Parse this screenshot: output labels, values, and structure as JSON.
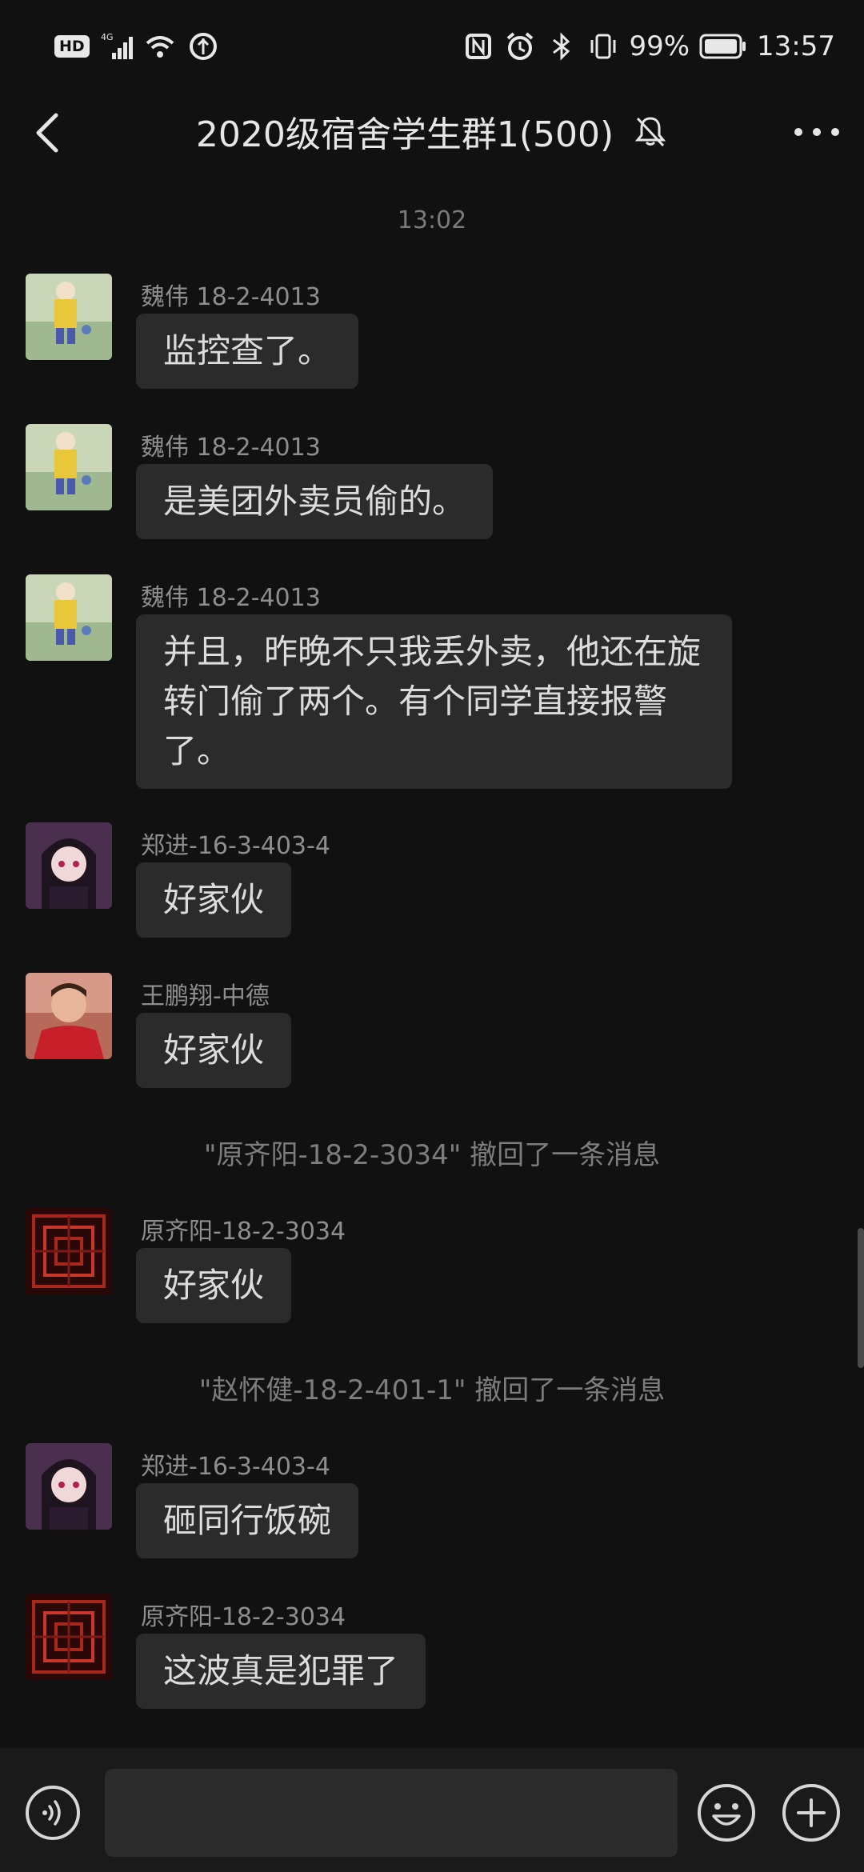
{
  "status_bar": {
    "hd_badge": "HD",
    "network": "4G",
    "battery_percent": "99%",
    "time": "13:57",
    "icons": [
      "hd-icon",
      "signal-icon",
      "wifi-icon",
      "data-saver-icon",
      "nfc-icon",
      "alarm-icon",
      "bluetooth-icon",
      "vibrate-icon",
      "battery-icon"
    ]
  },
  "header": {
    "title": "2020级宿舍学生群1(500)",
    "muted_icon": "bell-off-icon",
    "back_icon": "chevron-left-icon",
    "more_icon": "more-dots-icon"
  },
  "chat": {
    "timestamp": "13:02",
    "messages": [
      {
        "sender": "魏伟 18-2-4013",
        "text": "监控查了。",
        "avatar": "avatar-anime-girl"
      },
      {
        "sender": "魏伟 18-2-4013",
        "text": "是美团外卖员偷的。",
        "avatar": "avatar-anime-girl"
      },
      {
        "sender": "魏伟 18-2-4013",
        "text": "并且，昨晚不只我丢外卖，他还在旋转门偷了两个。有个同学直接报警了。",
        "avatar": "avatar-anime-girl"
      },
      {
        "sender": "郑进-16-3-403-4",
        "text": "好家伙",
        "avatar": "avatar-purple-anime"
      },
      {
        "sender": "王鹏翔-中德",
        "text": "好家伙",
        "avatar": "avatar-red-jersey"
      },
      {
        "sender": "原齐阳-18-2-3034",
        "text": "好家伙",
        "avatar": "avatar-red-pattern"
      },
      {
        "sender": "郑进-16-3-403-4",
        "text": "砸同行饭碗",
        "avatar": "avatar-purple-anime"
      },
      {
        "sender": "原齐阳-18-2-3034",
        "text": "这波真是犯罪了",
        "avatar": "avatar-red-pattern"
      }
    ],
    "recall_1": "\"原齐阳-18-2-3034\" 撤回了一条消息",
    "recall_2": "\"赵怀健-18-2-401-1\" 撤回了一条消息"
  },
  "input_bar": {
    "voice_icon": "voice-icon",
    "text_value": "",
    "emoji_icon": "emoji-icon",
    "plus_icon": "plus-icon"
  },
  "colors": {
    "background": "#111111",
    "bubble": "#2b2b2b",
    "text": "#dcdcdc",
    "meta_text": "#8e8e8e"
  }
}
